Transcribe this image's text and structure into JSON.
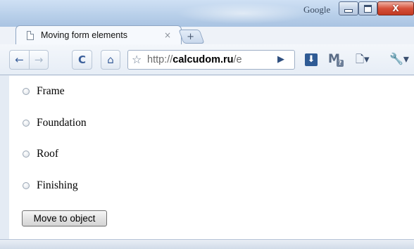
{
  "window": {
    "caption": "Google",
    "controls": {
      "minimize": "minimize",
      "maximize": "maximize",
      "close": "X"
    }
  },
  "tab": {
    "title": "Moving form elements",
    "close_glyph": "×",
    "new_tab_glyph": "+"
  },
  "toolbar": {
    "back_glyph": "←",
    "forward_glyph": "→",
    "reload_glyph": "C",
    "home_glyph": "⌂",
    "url_host": "calcudom.ru",
    "url_prefix": "http://",
    "url_suffix": "/e",
    "bookmark_glyph": "☆",
    "go_glyph": "▶",
    "icons": [
      "download-icon",
      "gmail-icon",
      "page-menu-icon",
      "wrench-menu-icon"
    ]
  },
  "form": {
    "options": [
      {
        "label": "Frame",
        "checked": false
      },
      {
        "label": "Foundation",
        "checked": false
      },
      {
        "label": "Roof",
        "checked": false
      },
      {
        "label": "Finishing",
        "checked": false
      }
    ],
    "button_label": "Move to object"
  },
  "colors": {
    "titlebar": "#b9d0ea",
    "close_button": "#c23a22",
    "content_bg": "#ffffff"
  }
}
